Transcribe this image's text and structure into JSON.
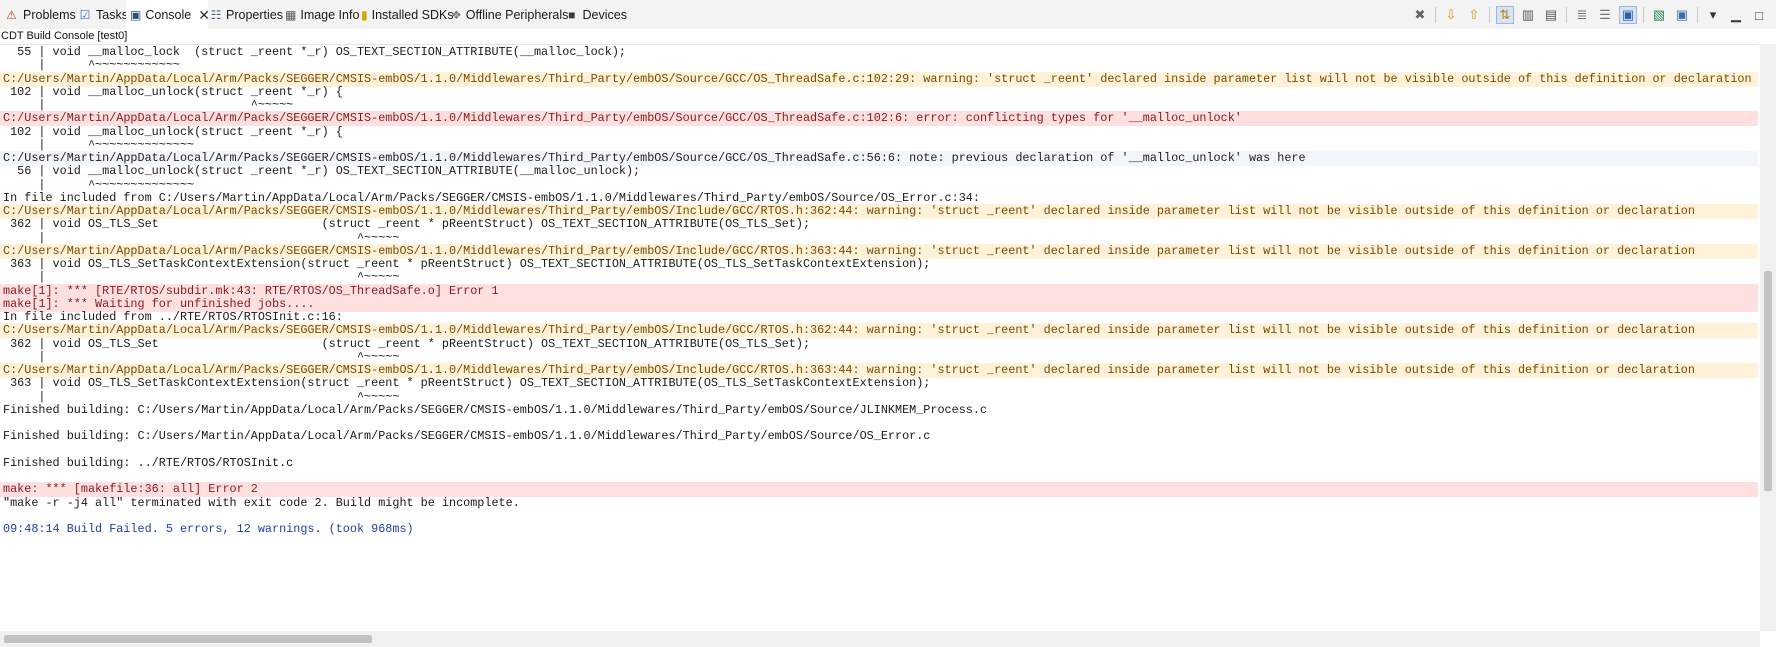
{
  "tabs": [
    {
      "label": "Problems",
      "icon": "problems-icon"
    },
    {
      "label": "Tasks",
      "icon": "tasks-icon"
    },
    {
      "label": "Console",
      "icon": "console-icon",
      "active": true
    },
    {
      "label": "Properties",
      "icon": "properties-icon"
    },
    {
      "label": "Image Info",
      "icon": "image-info-icon"
    },
    {
      "label": "Installed SDKs",
      "icon": "installed-sdks-icon"
    },
    {
      "label": "Offline Peripherals",
      "icon": "offline-peripherals-icon"
    },
    {
      "label": "Devices",
      "icon": "devices-icon"
    }
  ],
  "toolbar": [
    {
      "icon": "clear-console-icon"
    },
    {
      "icon": "next-error-icon"
    },
    {
      "icon": "previous-error-icon"
    },
    {
      "icon": "show-errors-only-icon",
      "pressed": true
    },
    {
      "icon": "scroll-lock-icon"
    },
    {
      "icon": "word-wrap-icon"
    },
    {
      "icon": "copy-build-log-icon"
    },
    {
      "icon": "pin-console-icon"
    },
    {
      "icon": "display-selected-console-icon",
      "pressed": true
    },
    {
      "icon": "open-console-icon"
    },
    {
      "icon": "new-console-view-icon"
    },
    {
      "icon": "view-menu-icon"
    },
    {
      "icon": "minimize-icon"
    },
    {
      "icon": "maximize-icon"
    }
  ],
  "console_title": "CDT Build Console [test0]",
  "console_lines": [
    {
      "type": "normal",
      "text": "  55 | void __malloc_lock  (struct _reent *_r) OS_TEXT_SECTION_ATTRIBUTE(__malloc_lock);"
    },
    {
      "type": "normal",
      "text": "     |      ^~~~~~~~~~~~~"
    },
    {
      "type": "warning",
      "text": "C:/Users/Martin/AppData/Local/Arm/Packs/SEGGER/CMSIS-embOS/1.1.0/Middlewares/Third_Party/embOS/Source/GCC/OS_ThreadSafe.c:102:29: warning: 'struct _reent' declared inside parameter list will not be visible outside of this definition or declaration"
    },
    {
      "type": "normal",
      "text": " 102 | void __malloc_unlock(struct _reent *_r) {"
    },
    {
      "type": "normal",
      "text": "     |                             ^~~~~~"
    },
    {
      "type": "error",
      "text": "C:/Users/Martin/AppData/Local/Arm/Packs/SEGGER/CMSIS-embOS/1.1.0/Middlewares/Third_Party/embOS/Source/GCC/OS_ThreadSafe.c:102:6: error: conflicting types for '__malloc_unlock'"
    },
    {
      "type": "normal",
      "text": " 102 | void __malloc_unlock(struct _reent *_r) {"
    },
    {
      "type": "normal",
      "text": "     |      ^~~~~~~~~~~~~~~"
    },
    {
      "type": "info",
      "text": "C:/Users/Martin/AppData/Local/Arm/Packs/SEGGER/CMSIS-embOS/1.1.0/Middlewares/Third_Party/embOS/Source/GCC/OS_ThreadSafe.c:56:6: note: previous declaration of '__malloc_unlock' was here"
    },
    {
      "type": "normal",
      "text": "  56 | void __malloc_unlock(struct _reent *_r) OS_TEXT_SECTION_ATTRIBUTE(__malloc_unlock);"
    },
    {
      "type": "normal",
      "text": "     |      ^~~~~~~~~~~~~~~"
    },
    {
      "type": "normal",
      "text": "In file included from C:/Users/Martin/AppData/Local/Arm/Packs/SEGGER/CMSIS-embOS/1.1.0/Middlewares/Third_Party/embOS/Source/OS_Error.c:34:"
    },
    {
      "type": "warning",
      "text": "C:/Users/Martin/AppData/Local/Arm/Packs/SEGGER/CMSIS-embOS/1.1.0/Middlewares/Third_Party/embOS/Include/GCC/RTOS.h:362:44: warning: 'struct _reent' declared inside parameter list will not be visible outside of this definition or declaration"
    },
    {
      "type": "normal",
      "text": " 362 | void OS_TLS_Set                       (struct _reent * pReentStruct) OS_TEXT_SECTION_ATTRIBUTE(OS_TLS_Set);"
    },
    {
      "type": "normal",
      "text": "     |                                            ^~~~~~"
    },
    {
      "type": "warning",
      "text": "C:/Users/Martin/AppData/Local/Arm/Packs/SEGGER/CMSIS-embOS/1.1.0/Middlewares/Third_Party/embOS/Include/GCC/RTOS.h:363:44: warning: 'struct _reent' declared inside parameter list will not be visible outside of this definition or declaration"
    },
    {
      "type": "normal",
      "text": " 363 | void OS_TLS_SetTaskContextExtension(struct _reent * pReentStruct) OS_TEXT_SECTION_ATTRIBUTE(OS_TLS_SetTaskContextExtension);"
    },
    {
      "type": "normal",
      "text": "     |                                            ^~~~~~"
    },
    {
      "type": "error",
      "text": "make[1]: *** [RTE/RTOS/subdir.mk:43: RTE/RTOS/OS_ThreadSafe.o] Error 1"
    },
    {
      "type": "error",
      "text": "make[1]: *** Waiting for unfinished jobs...."
    },
    {
      "type": "normal",
      "text": "In file included from ../RTE/RTOS/RTOSInit.c:16:"
    },
    {
      "type": "warning",
      "text": "C:/Users/Martin/AppData/Local/Arm/Packs/SEGGER/CMSIS-embOS/1.1.0/Middlewares/Third_Party/embOS/Include/GCC/RTOS.h:362:44: warning: 'struct _reent' declared inside parameter list will not be visible outside of this definition or declaration"
    },
    {
      "type": "normal",
      "text": " 362 | void OS_TLS_Set                       (struct _reent * pReentStruct) OS_TEXT_SECTION_ATTRIBUTE(OS_TLS_Set);"
    },
    {
      "type": "normal",
      "text": "     |                                            ^~~~~~"
    },
    {
      "type": "warning",
      "text": "C:/Users/Martin/AppData/Local/Arm/Packs/SEGGER/CMSIS-embOS/1.1.0/Middlewares/Third_Party/embOS/Include/GCC/RTOS.h:363:44: warning: 'struct _reent' declared inside parameter list will not be visible outside of this definition or declaration"
    },
    {
      "type": "normal",
      "text": " 363 | void OS_TLS_SetTaskContextExtension(struct _reent * pReentStruct) OS_TEXT_SECTION_ATTRIBUTE(OS_TLS_SetTaskContextExtension);"
    },
    {
      "type": "normal",
      "text": "     |                                            ^~~~~~"
    },
    {
      "type": "normal",
      "text": "Finished building: C:/Users/Martin/AppData/Local/Arm/Packs/SEGGER/CMSIS-embOS/1.1.0/Middlewares/Third_Party/embOS/Source/JLINKMEM_Process.c"
    },
    {
      "type": "normal",
      "text": " "
    },
    {
      "type": "normal",
      "text": "Finished building: C:/Users/Martin/AppData/Local/Arm/Packs/SEGGER/CMSIS-embOS/1.1.0/Middlewares/Third_Party/embOS/Source/OS_Error.c"
    },
    {
      "type": "normal",
      "text": " "
    },
    {
      "type": "normal",
      "text": "Finished building: ../RTE/RTOS/RTOSInit.c"
    },
    {
      "type": "normal",
      "text": " "
    },
    {
      "type": "error",
      "text": "make: *** [makefile:36: all] Error 2"
    },
    {
      "type": "normal",
      "text": "\"make -r -j4 all\" terminated with exit code 2. Build might be incomplete."
    },
    {
      "type": "normal",
      "text": " "
    },
    {
      "type": "status",
      "text": "09:48:14 Build Failed. 5 errors, 12 warnings. (took 968ms)"
    }
  ],
  "colors": {
    "warning_bg": "#fff2d9",
    "error_bg": "#fde0df",
    "info_bg": "#f2f5fc",
    "status_text": "#1f3fa8"
  },
  "scroll": {
    "vertical_position": 0.62,
    "vertical_visible_fraction": 0.38,
    "horizontal_position": 0.0,
    "horizontal_visible_fraction": 0.21
  }
}
